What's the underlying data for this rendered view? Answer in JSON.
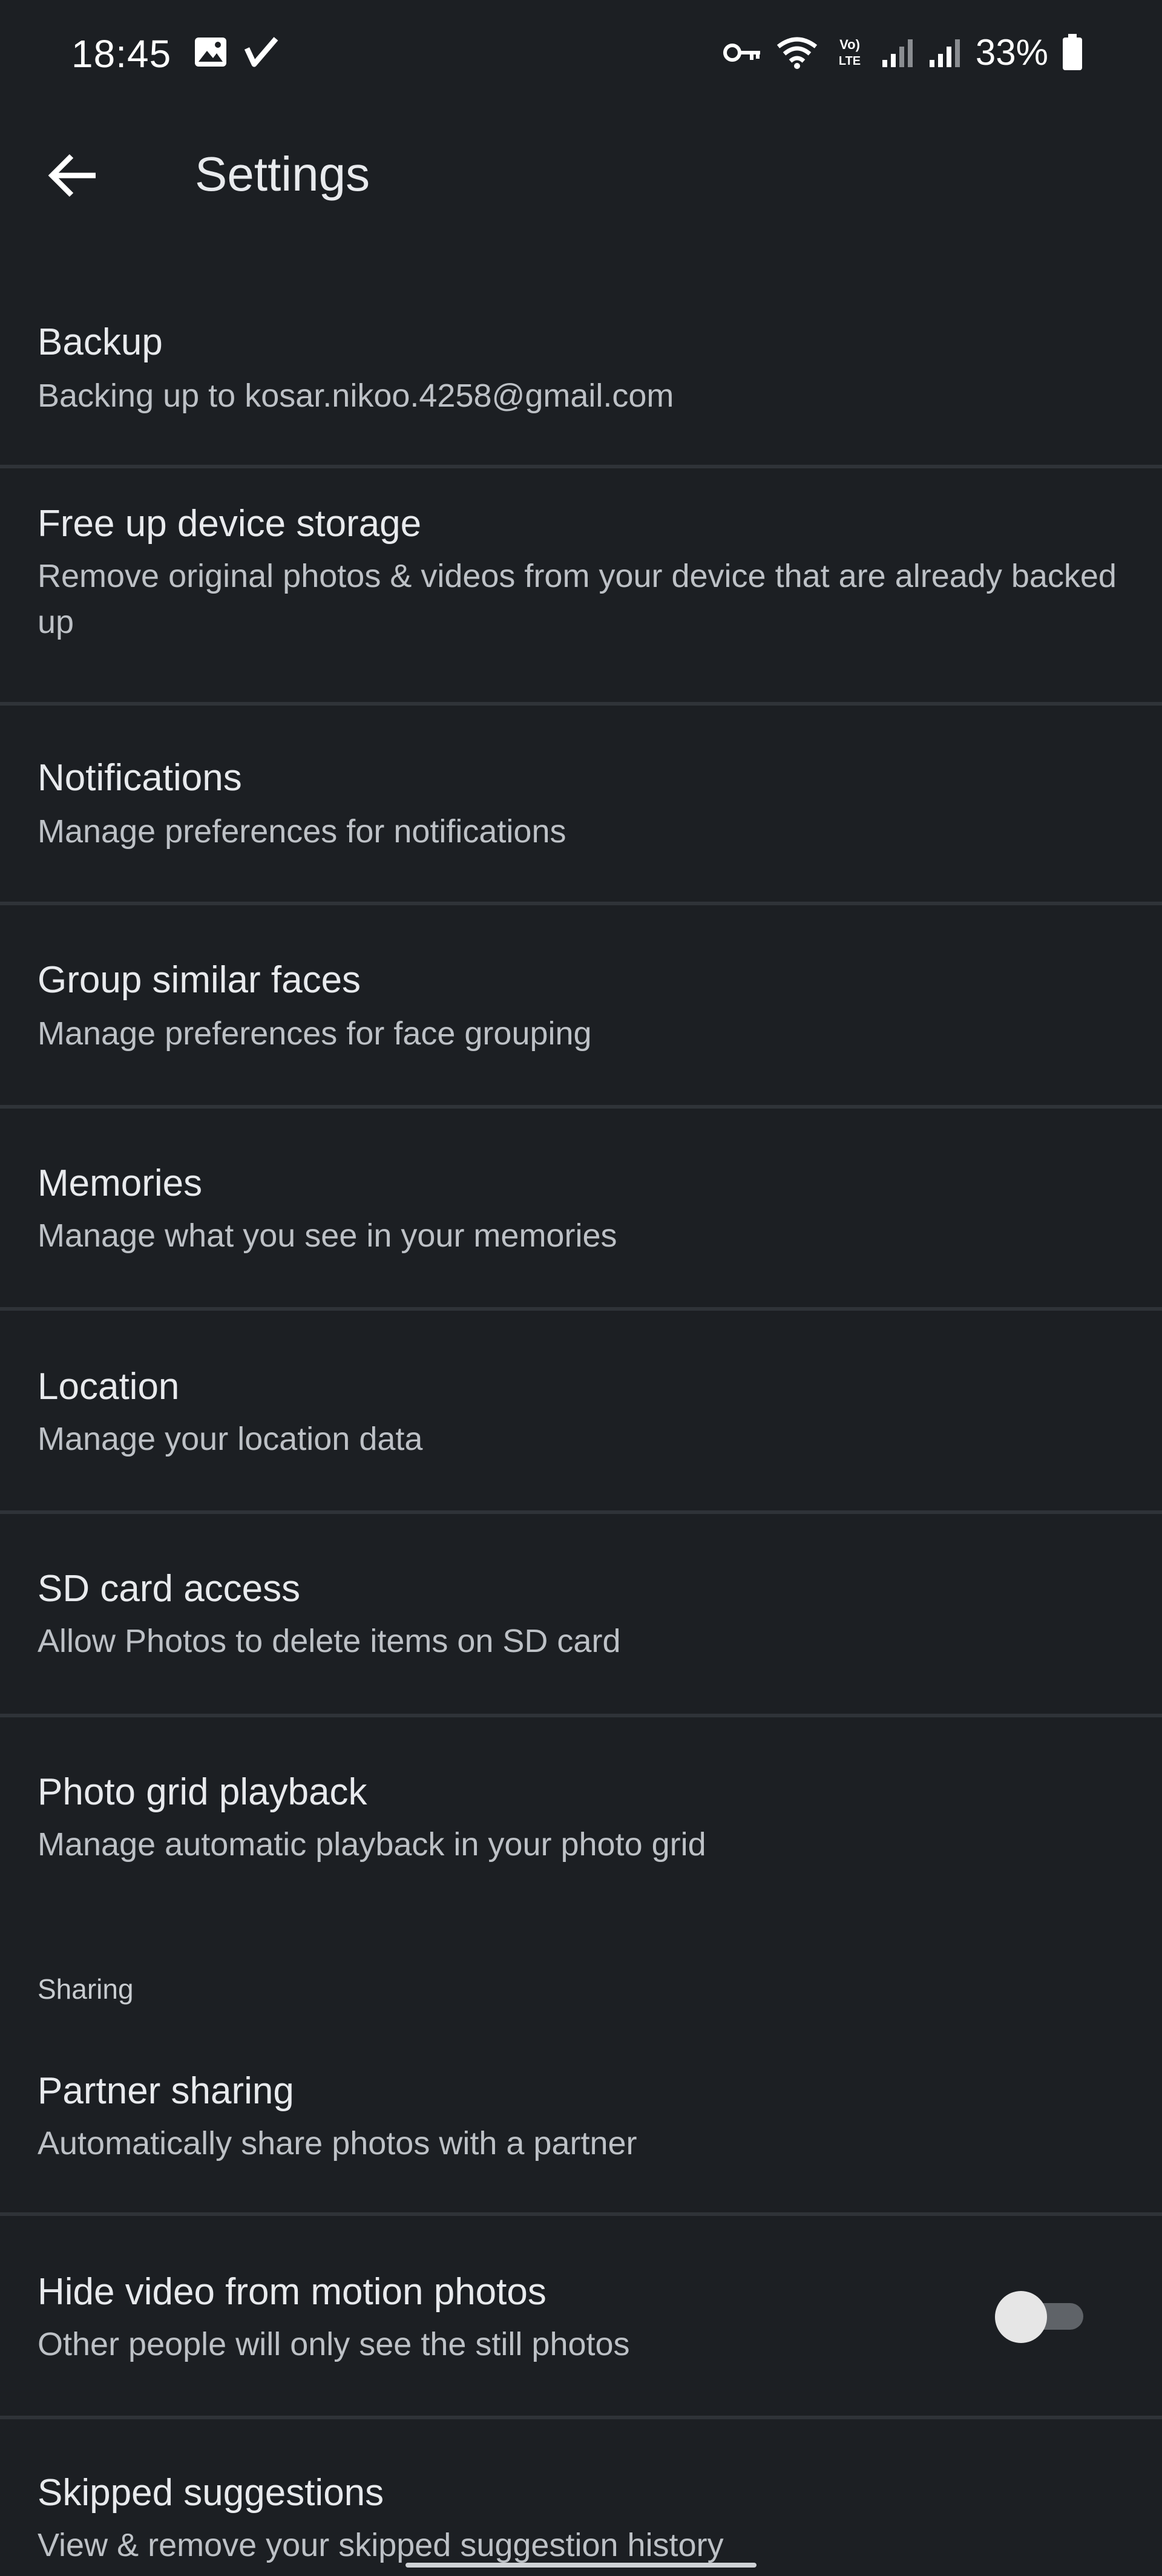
{
  "status_bar": {
    "time": "18:45",
    "battery": "33%",
    "icons_left": [
      "image-icon",
      "check-mark-icon"
    ],
    "icons_right": [
      "key-icon",
      "wifi-icon",
      "volte-lte-icon",
      "signal-icon",
      "signal-icon",
      "battery-icon"
    ]
  },
  "app_bar": {
    "back_icon": "arrow-back-icon",
    "title": "Settings"
  },
  "settings": [
    {
      "title": "Backup",
      "subtitle": "Backing up to kosar.nikoo.4258@gmail.com"
    },
    {
      "title": "Free up device storage",
      "subtitle": "Remove original photos & videos from your device that are already backed up"
    },
    {
      "title": "Notifications",
      "subtitle": "Manage preferences for notifications"
    },
    {
      "title": "Group similar faces",
      "subtitle": "Manage preferences for face grouping"
    },
    {
      "title": "Memories",
      "subtitle": "Manage what you see in your memories"
    },
    {
      "title": "Location",
      "subtitle": "Manage your location data"
    },
    {
      "title": "SD card access",
      "subtitle": "Allow Photos to delete items on SD card"
    },
    {
      "title": "Photo grid playback",
      "subtitle": "Manage automatic playback in your photo grid"
    }
  ],
  "sharing_section": {
    "header": "Sharing",
    "items": [
      {
        "title": "Partner sharing",
        "subtitle": "Automatically share photos with a partner"
      },
      {
        "title": "Hide video from motion photos",
        "subtitle": "Other people will only see the still photos",
        "toggle": "off"
      },
      {
        "title": "Skipped suggestions",
        "subtitle": "View & remove your skipped suggestion history"
      }
    ]
  },
  "colors": {
    "background": "#1c1f23",
    "divider": "#2f3338",
    "title_text": "#e8eaed",
    "subtitle_text": "#bdc1c6"
  }
}
